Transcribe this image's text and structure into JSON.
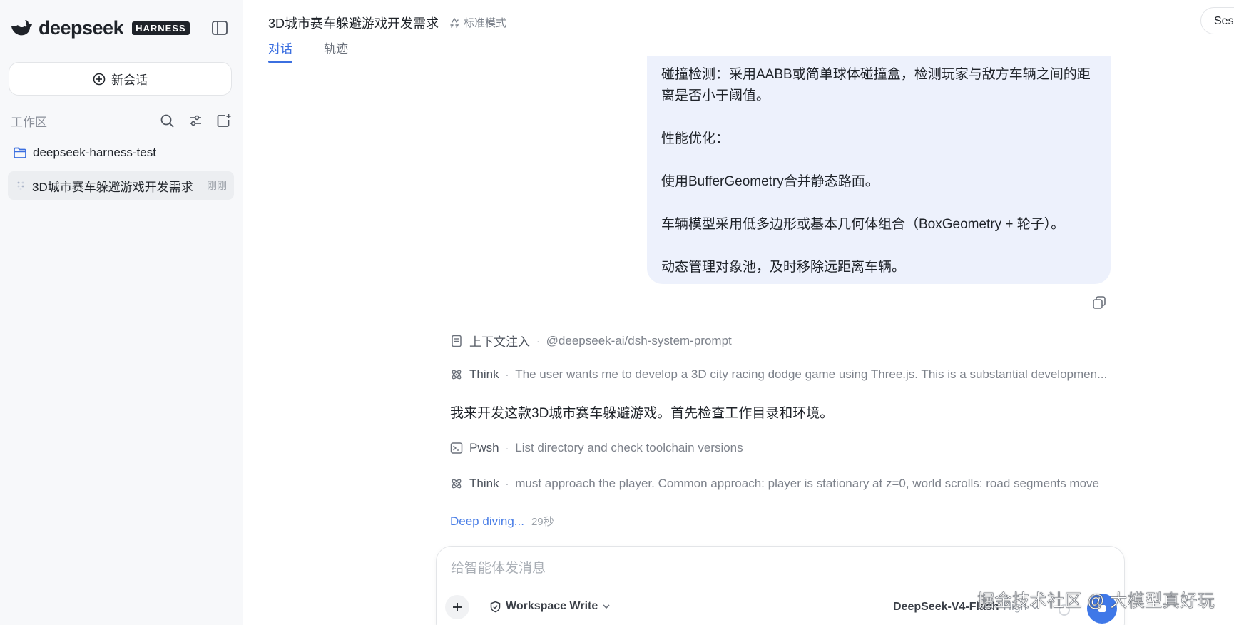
{
  "sidebar": {
    "brand_name": "deepseek",
    "brand_badge": "HARNESS",
    "new_chat_label": "新会话",
    "workspace_label": "工作区",
    "folder_name": "deepseek-harness-test",
    "session": {
      "title": "3D城市赛车躲避游戏开发需求",
      "time": "刚刚"
    }
  },
  "header": {
    "title": "3D城市赛车躲避游戏开发需求",
    "mode": "标准模式",
    "tabs": [
      {
        "label": "对话"
      },
      {
        "label": "轨迹"
      }
    ],
    "session_button": "Sess"
  },
  "message": {
    "paragraphs": [
      "碰撞检测：采用AABB或简单球体碰撞盒，检测玩家与敌方车辆之间的距离是否小于阈值。",
      "性能优化：",
      "使用BufferGeometry合并静态路面。",
      "车辆模型采用低多边形或基本几何体组合（BoxGeometry + 轮子）。",
      "动态管理对象池，及时移除远距离车辆。"
    ]
  },
  "trace": {
    "context": {
      "name": "上下文注入",
      "desc": "@deepseek-ai/dsh-system-prompt"
    },
    "think1": {
      "name": "Think",
      "desc": "The user wants me to develop a 3D city racing dodge game using Three.js. This is a substantial developmen..."
    },
    "reply": "我来开发这款3D城市赛车躲避游戏。首先检查工作目录和环境。",
    "pwsh": {
      "name": "Pwsh",
      "desc": "List directory and check toolchain versions"
    },
    "think2": {
      "name": "Think",
      "desc": " must approach the player. Common approach: player is stationary at z=0, world scrolls: road segments move"
    },
    "status": {
      "label": "Deep diving...",
      "seconds": "29秒"
    }
  },
  "composer": {
    "placeholder": "给智能体发消息",
    "workspace_mode": "Workspace Write",
    "model": "DeepSeek-V4-Flash",
    "effort": "High"
  },
  "watermark": "掘金技术社区 @ 大模型真好玩",
  "colors": {
    "accent": "#3b6fe0",
    "bubble": "#edf1fc",
    "sidebar_bg": "#f7f8fa"
  }
}
